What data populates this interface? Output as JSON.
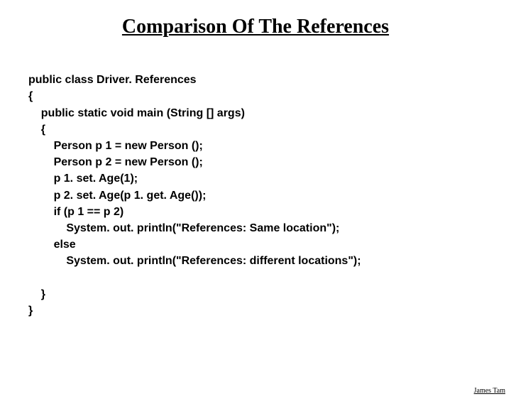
{
  "title": "Comparison Of The References",
  "code": {
    "l1": "public class Driver. References",
    "l2": "{",
    "l3": "    public static void main (String [] args)",
    "l4": "    {",
    "l5": "        Person p 1 = new Person ();",
    "l6": "        Person p 2 = new Person ();",
    "l7": "        p 1. set. Age(1);",
    "l8": "        p 2. set. Age(p 1. get. Age());",
    "l9": "        if (p 1 == p 2)",
    "l10": "            System. out. println(\"References: Same location\");",
    "l11": "        else",
    "l12": "            System. out. println(\"References: different locations\");",
    "l13": "",
    "l14": "    }",
    "l15": "}"
  },
  "footer": "James Tam"
}
